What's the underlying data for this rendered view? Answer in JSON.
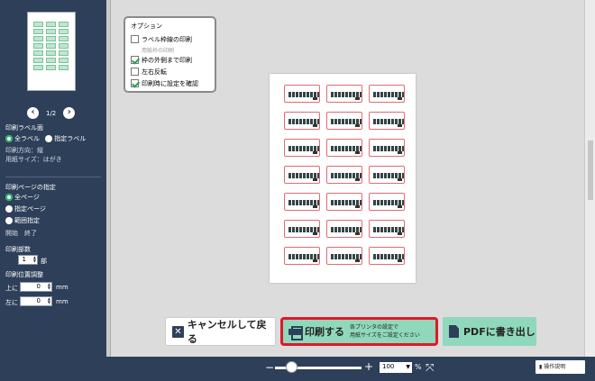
{
  "sidebar": {
    "page_indicator": "1/2",
    "print_label_heading": "印刷ラベル面",
    "all_labels": "全ラベル",
    "selected_labels": "指定ラベル",
    "print_direction": "印刷方向：縦",
    "paper_size": "用紙サイズ：はがき",
    "page_spec_heading": "印刷ページの指定",
    "all_pages": "全ページ",
    "specified_page": "指定ページ",
    "range_specified": "範囲指定",
    "start_end": "開始　終了",
    "copies_heading": "印刷部数",
    "copies_value": "1",
    "copies_unit": "部",
    "position_heading": "印刷位置調整",
    "top_label": "上に",
    "top_value": "0",
    "left_label": "左に",
    "left_value": "0",
    "unit_mm": "mm"
  },
  "options": {
    "title": "オプション",
    "label_frame": "ラベル枠線の印刷",
    "in_frame": "用紙枠の印刷",
    "print_outside": "枠の外側まで印刷",
    "mirror": "左右反転",
    "confirm_settings": "印刷時に設定を確認"
  },
  "buttons": {
    "cancel": "キャンセルして戻る",
    "print": "印刷する",
    "print_note_1": "各プリンタの設定で",
    "print_note_2": "用紙サイズをご設定ください",
    "pdf": "PDFに書き出し"
  },
  "bottom": {
    "zoom_value": "100",
    "zoom_unit": "%",
    "help": "操作説明"
  },
  "colors": {
    "sidebar": "#2d3f59",
    "accent_green": "#8fd8bb",
    "highlight_red": "#e2172a",
    "label_border": "#e26b72"
  }
}
